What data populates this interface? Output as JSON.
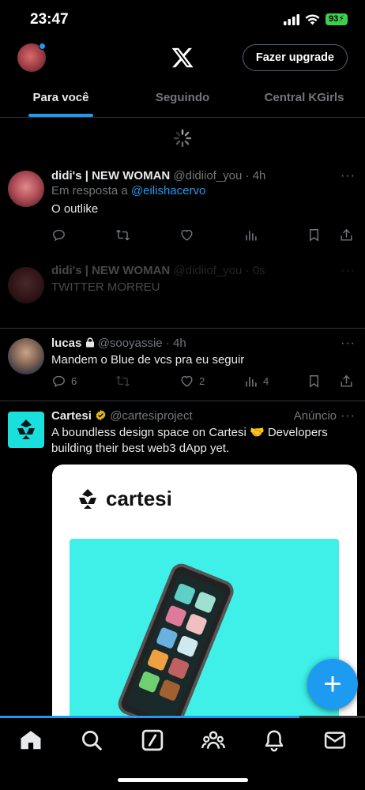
{
  "status_bar": {
    "time": "23:47",
    "battery": "93"
  },
  "header": {
    "upgrade_label": "Fazer upgrade"
  },
  "tabs": [
    {
      "label": "Para você",
      "active": true
    },
    {
      "label": "Seguindo",
      "active": false
    },
    {
      "label": "Central KGirls",
      "active": false
    }
  ],
  "tweets": [
    {
      "name": "didi's | NEW WOMAN",
      "handle": "@didiiof_you",
      "time": "· 4h",
      "reply_prefix": "Em resposta a",
      "reply_to": "@eilishacervo",
      "text": "O outlike"
    },
    {
      "name": "didi's | NEW WOMAN",
      "handle": "@didiiof_you",
      "time": "· 0s",
      "text": "TWITTER MORREU"
    },
    {
      "name": "lucas",
      "handle": "@sooyassie",
      "time": "· 4h",
      "text": "Mandem o Blue de vcs pra eu seguir",
      "replies": "6",
      "likes": "2",
      "views": "4"
    },
    {
      "name": "Cartesi",
      "handle": "@cartesiproject",
      "ad_label": "Anúncio",
      "text": "A boundless design space on Cartesi 🤝 Developers building their best web3 dApp yet.",
      "card_brand": "cartesi"
    }
  ],
  "more_label": "···",
  "fab_label": "+",
  "video_progress": 0.82,
  "colors": {
    "accent": "#1d9bf0",
    "background": "#000000",
    "battery": "#3ccf4e",
    "ad_card_teal": "#3ef0e8"
  }
}
